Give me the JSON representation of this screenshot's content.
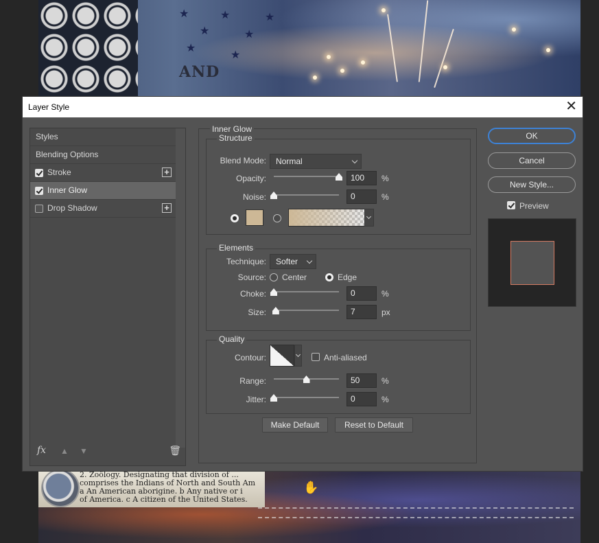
{
  "dialog": {
    "title": "Layer Style",
    "close_glyph": "✕"
  },
  "left_panel": {
    "items": [
      {
        "label": "Styles",
        "checkbox": false,
        "checked": false,
        "selected": false,
        "has_add": false
      },
      {
        "label": "Blending Options",
        "checkbox": false,
        "checked": false,
        "selected": false,
        "has_add": false
      },
      {
        "label": "Stroke",
        "checkbox": true,
        "checked": true,
        "selected": false,
        "has_add": true
      },
      {
        "label": "Inner Glow",
        "checkbox": true,
        "checked": true,
        "selected": true,
        "has_add": false
      },
      {
        "label": "Drop Shadow",
        "checkbox": true,
        "checked": false,
        "selected": false,
        "has_add": true
      }
    ],
    "footer": {
      "fx_label": "fx",
      "trash_icon": "trash-icon",
      "up_icon": "arrow-up-icon",
      "down_icon": "arrow-down-icon"
    }
  },
  "inner_glow": {
    "title": "Inner Glow",
    "structure": {
      "title": "Structure",
      "blend_mode": {
        "label": "Blend Mode:",
        "value": "Normal"
      },
      "opacity": {
        "label": "Opacity:",
        "value": "100",
        "unit": "%",
        "level": 1.0
      },
      "noise": {
        "label": "Noise:",
        "value": "0",
        "unit": "%",
        "level": 0.0
      },
      "color_mode": "color",
      "swatch_color": "#cdb896"
    },
    "elements": {
      "title": "Elements",
      "technique": {
        "label": "Technique:",
        "value": "Softer"
      },
      "source": {
        "label": "Source:",
        "options": [
          "Center",
          "Edge"
        ],
        "selected": "Edge"
      },
      "choke": {
        "label": "Choke:",
        "value": "0",
        "unit": "%",
        "level": 0.0
      },
      "size": {
        "label": "Size:",
        "value": "7",
        "unit": "px",
        "level": 0.03
      }
    },
    "quality": {
      "title": "Quality",
      "contour_label": "Contour:",
      "anti_aliased": {
        "label": "Anti-aliased",
        "checked": false
      },
      "range": {
        "label": "Range:",
        "value": "50",
        "unit": "%",
        "level": 0.5
      },
      "jitter": {
        "label": "Jitter:",
        "value": "0",
        "unit": "%",
        "level": 0.0
      }
    },
    "make_default": "Make Default",
    "reset_default": "Reset to Default"
  },
  "right": {
    "ok": "OK",
    "cancel": "Cancel",
    "new_style": "New Style...",
    "preview": {
      "label": "Preview",
      "checked": true
    }
  },
  "canvas": {
    "and_text": "AND",
    "dict_lines": [
      "2. Zoölogy. Designating that division of ...",
      "comprises the Indians of North and South Am",
      "a An American aborigine.  b Any native or i",
      "of America.  c A citizen of the United States."
    ]
  },
  "colors": {
    "accent": "#3d82d6",
    "preview_border": "#d57c64"
  }
}
